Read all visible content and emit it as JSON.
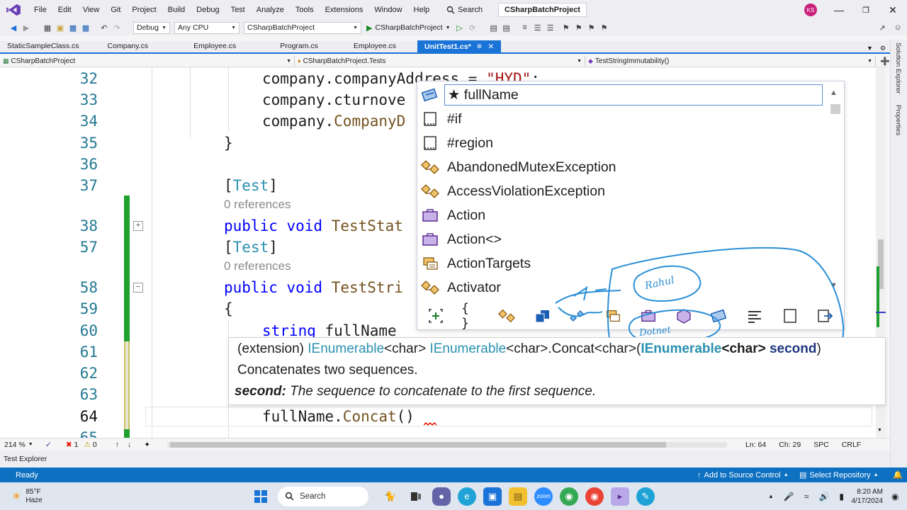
{
  "menu": {
    "items": [
      "File",
      "Edit",
      "View",
      "Git",
      "Project",
      "Build",
      "Debug",
      "Test",
      "Analyze",
      "Tools",
      "Extensions",
      "Window",
      "Help"
    ],
    "search_label": "Search",
    "solution_title": "CSharpBatchProject",
    "avatar_initials": "KS"
  },
  "toolbar": {
    "config": "Debug",
    "platform": "Any CPU",
    "startup_project": "CSharpBatchProject",
    "run_label": "CSharpBatchProject"
  },
  "tabs": [
    {
      "label": "StaticSampleClass.cs"
    },
    {
      "label": "Company.cs"
    },
    {
      "label": "Employee.cs"
    },
    {
      "label": "Program.cs"
    },
    {
      "label": "Employee.cs"
    },
    {
      "label": "UnitTest1.cs*",
      "active": true
    }
  ],
  "navbar": {
    "project": "CSharpBatchProject",
    "class": "CSharpBatchProject.Tests",
    "member": "TestStringImmutability()"
  },
  "sidebar": {
    "solution_explorer": "Solution Explorer",
    "properties": "Properties"
  },
  "editor": {
    "line_numbers": [
      "32",
      "33",
      "34",
      "35",
      "36",
      "37",
      "38",
      "57",
      "58",
      "59",
      "60",
      "61",
      "62",
      "63",
      "64",
      "65"
    ],
    "codelens": "0 references",
    "code": {
      "l32_a": "company.",
      "l32_b": "companyAddress = ",
      "l32_c": "\"HYD\"",
      "l32_d": ";",
      "l33": "company.cturnove",
      "l34_a": "company.",
      "l34_b": "CompanyD",
      "l35": "}",
      "l37_open": "[",
      "l37_attr": "Test",
      "l37_close": "]",
      "l38_kw": "public void ",
      "l38_name": "TestStat",
      "l57_open": "[",
      "l57_attr": "Test",
      "l57_close": "]",
      "l58_kw": "public void ",
      "l58_name": "TestStri",
      "l59": "{",
      "l60_kw": "string ",
      "l60_rest": "fullName",
      "l64_a": "fullName.",
      "l64_b": "Concat",
      "l64_c": "()"
    }
  },
  "intellisense": {
    "items": [
      {
        "label": "★ fullName",
        "icon": "local-variable-icon",
        "selected": true
      },
      {
        "label": "#if",
        "icon": "snippet-icon"
      },
      {
        "label": "#region",
        "icon": "snippet-icon"
      },
      {
        "label": "AbandonedMutexException",
        "icon": "class-icon"
      },
      {
        "label": "AccessViolationException",
        "icon": "class-icon"
      },
      {
        "label": "Action",
        "icon": "delegate-icon"
      },
      {
        "label": "Action<>",
        "icon": "delegate-icon"
      },
      {
        "label": "ActionTargets",
        "icon": "enum-icon"
      },
      {
        "label": "Activator",
        "icon": "class-icon"
      }
    ],
    "filters": [
      "namespace-filter-icon",
      "braces-filter-icon",
      "class-filter-icon",
      "struct-filter-icon",
      "interface-filter-icon",
      "enum-filter-icon",
      "delegate-filter-icon",
      "module-filter-icon",
      "field-filter-icon",
      "property-filter-icon",
      "keyword-filter-icon",
      "snippet-filter-icon",
      "extension-filter-icon"
    ]
  },
  "annotation": {
    "label1": "Rahul",
    "label2": "Dotnet"
  },
  "quickinfo": {
    "prefix": "(extension) ",
    "t1": "IEnumerable",
    "t2": "<char> ",
    "t3": "IEnumerable",
    "t4": "<char>.Concat<char>(",
    "t5": "IEnumerable",
    "t6": "<char> ",
    "t7": "second",
    "t8": ")",
    "summary": "Concatenates two sequences.",
    "param_name": "second:",
    "param_desc": " The sequence to concatenate to the first sequence."
  },
  "editor_status": {
    "zoom": "214 %",
    "errors": "1",
    "warnings": "0",
    "position": "Ln: 64",
    "column": "Ch: 29",
    "mode": "SPC",
    "line_endings": "CRLF"
  },
  "panels": {
    "test_explorer": "Test Explorer"
  },
  "statusbar": {
    "ready": "Ready",
    "source_control": "Add to Source Control",
    "repository": "Select Repository"
  },
  "taskbar": {
    "weather_temp": "85°F",
    "weather_desc": "Haze",
    "search": "Search",
    "time": "8:20 AM",
    "date": "4/17/2024"
  },
  "colors": {
    "accent": "#1a73d6",
    "statusbar": "#0e70c0",
    "keyword": "#0000ff",
    "type": "#2b91af",
    "string": "#a31515",
    "annotation_ink": "#2a8fd6"
  }
}
